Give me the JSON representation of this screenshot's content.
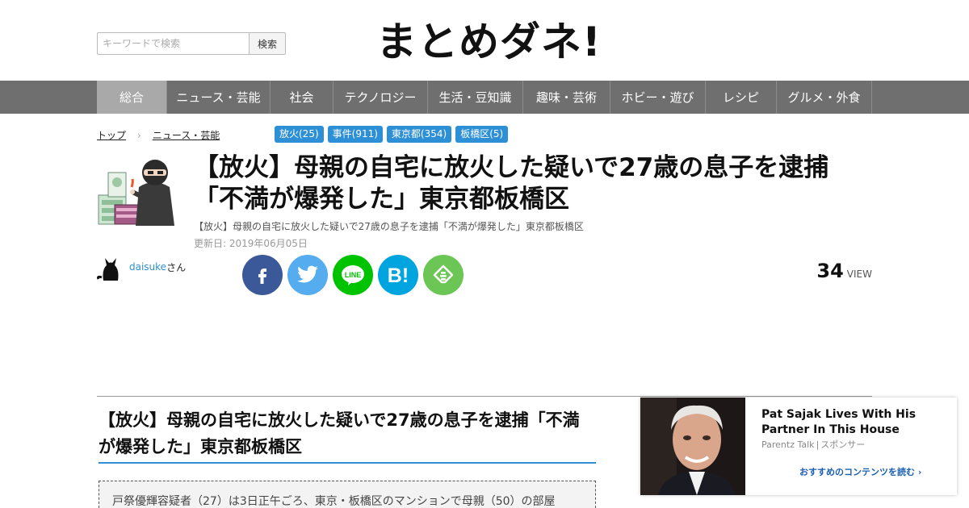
{
  "search": {
    "placeholder": "キーワードで検索",
    "button_label": "検索"
  },
  "site": {
    "logo": "まとめダネ!"
  },
  "nav": {
    "items": [
      "総合",
      "ニュース・芸能",
      "社会",
      "テクノロジー",
      "生活・豆知識",
      "趣味・芸術",
      "ホビー・遊び",
      "レシピ",
      "グルメ・外食"
    ]
  },
  "breadcrumb": {
    "home": "トップ",
    "separator": "›",
    "category": "ニュース・芸能"
  },
  "tags": [
    "放火(25)",
    "事件(911)",
    "東京都(354)",
    "板橋区(5)"
  ],
  "article": {
    "title": "【放火】母親の自宅に放火した疑いで27歳の息子を逮捕「不満が爆発した」東京都板橋区",
    "subtitle": "【放火】母親の自宅に放火した疑いで27歳の息子を逮捕「不満が爆発した」東京都板橋区",
    "updated": "更新日: 2019年06月05日",
    "author": "daisuke",
    "author_suffix": "さん",
    "views": "34",
    "views_label": "VIEW",
    "section_heading": "【放火】母親の自宅に放火した疑いで27歳の息子を逮捕「不満が爆発した」東京都板橋区",
    "quote_text": "戸祭優輝容疑者（27）は3日正午ごろ、東京・板橋区のマンションで母親（50）の部屋"
  },
  "share": [
    "facebook",
    "twitter",
    "line",
    "hatena",
    "feedly"
  ],
  "share_colors": {
    "facebook": "#3b5998",
    "twitter": "#1da1f2",
    "line": "#00c300",
    "hatena": "#00a4de",
    "feedly": "#6cc655"
  },
  "ad": {
    "title": "Pat Sajak Lives With His Partner In This House",
    "source": "Parentz Talk",
    "sponsor": "スポンサー",
    "more": "おすすめのコンテンツを読む"
  },
  "colors": {
    "accent": "#2d8fd5",
    "nav_bg": "#6f6f6f",
    "nav_active": "#a9a9a9"
  }
}
